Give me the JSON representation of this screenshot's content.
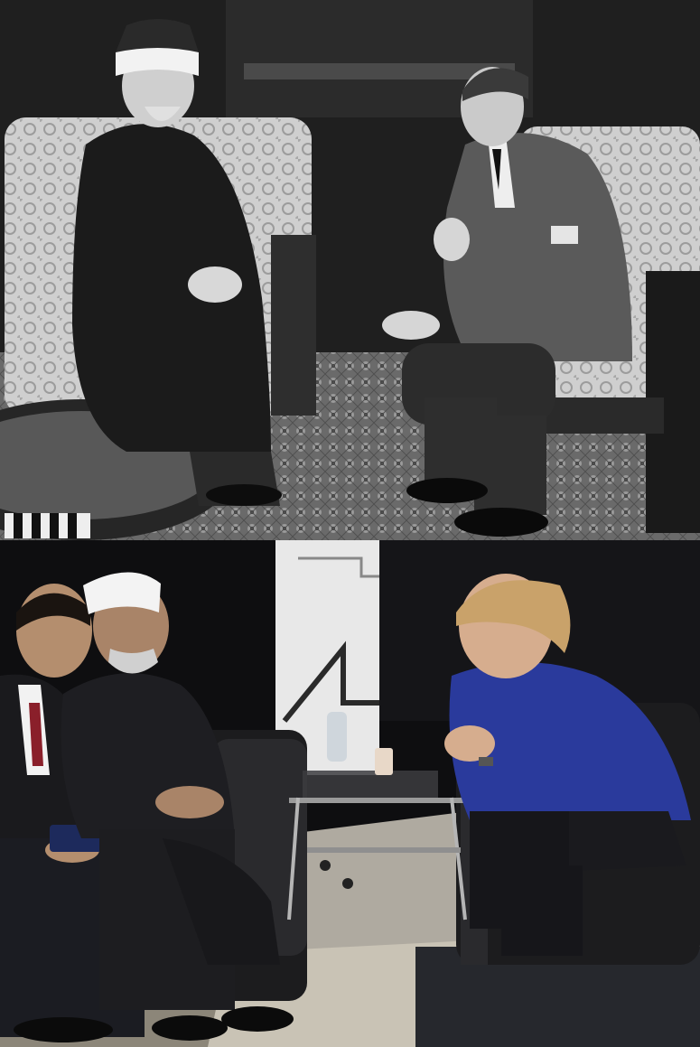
{
  "image": {
    "layout": "two-panel-vertical",
    "panels": [
      {
        "id": "top",
        "style": "black-and-white-photograph",
        "scene": "two-seated-men-conversing-in-ornate-room"
      },
      {
        "id": "bottom",
        "style": "color-photograph",
        "scene": "three-seated-people-conversing-around-glass-table"
      }
    ]
  },
  "colors": {
    "divider": "#ffffff",
    "jacket_blue": "#2a3a9c",
    "hair_blonde": "#c9a26a",
    "sofa_dark": "#1c1c1e"
  }
}
